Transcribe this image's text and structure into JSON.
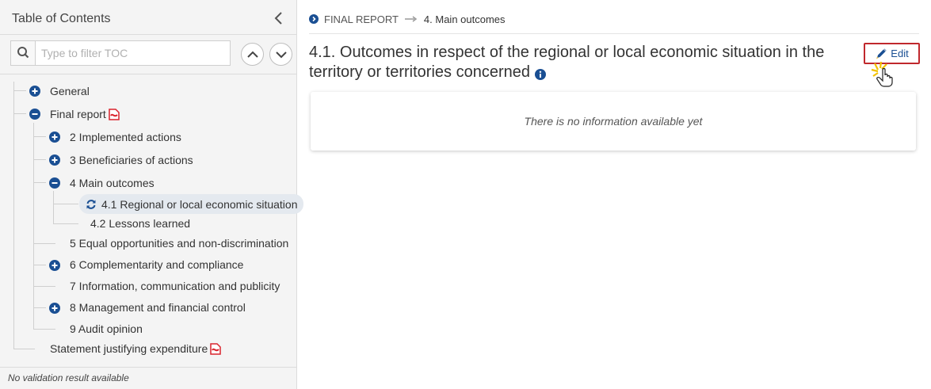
{
  "sidebar": {
    "title": "Table of Contents",
    "filter_placeholder": "Type to filter TOC",
    "footer_text": "No validation result available",
    "tree": {
      "general": "General",
      "final_report": "Final report",
      "implemented_actions": "2 Implemented actions",
      "beneficiaries": "3 Beneficiaries of actions",
      "main_outcomes": "4 Main outcomes",
      "regional_situation": "4.1 Regional or local economic situation",
      "lessons_learned": "4.2 Lessons learned",
      "equal_opportunities": "5 Equal opportunities and non-discrimination",
      "complementarity": "6 Complementarity and compliance",
      "information": "7 Information, communication and publicity",
      "management": "8 Management and financial control",
      "audit_opinion": "9 Audit opinion",
      "statement": "Statement justifying expenditure"
    }
  },
  "breadcrumb": {
    "root": "FINAL REPORT",
    "current": "4. Main outcomes"
  },
  "main": {
    "section_title": "4.1. Outcomes in respect of the regional or local economic situation in the territory or territories concerned",
    "edit_label": "Edit",
    "empty_message": "There is no information available yet"
  },
  "colors": {
    "accent_blue": "#1a4f93",
    "highlight_red": "#c0282d",
    "selected_bg": "#e4e9ef",
    "pdf_red": "#d9232d"
  },
  "icons": {
    "expand": "plus-circle-icon",
    "collapse": "minus-circle-icon",
    "pdf": "pdf-icon",
    "refresh": "refresh-icon",
    "info": "info-icon",
    "edit": "pencil-icon",
    "search": "search-icon"
  }
}
